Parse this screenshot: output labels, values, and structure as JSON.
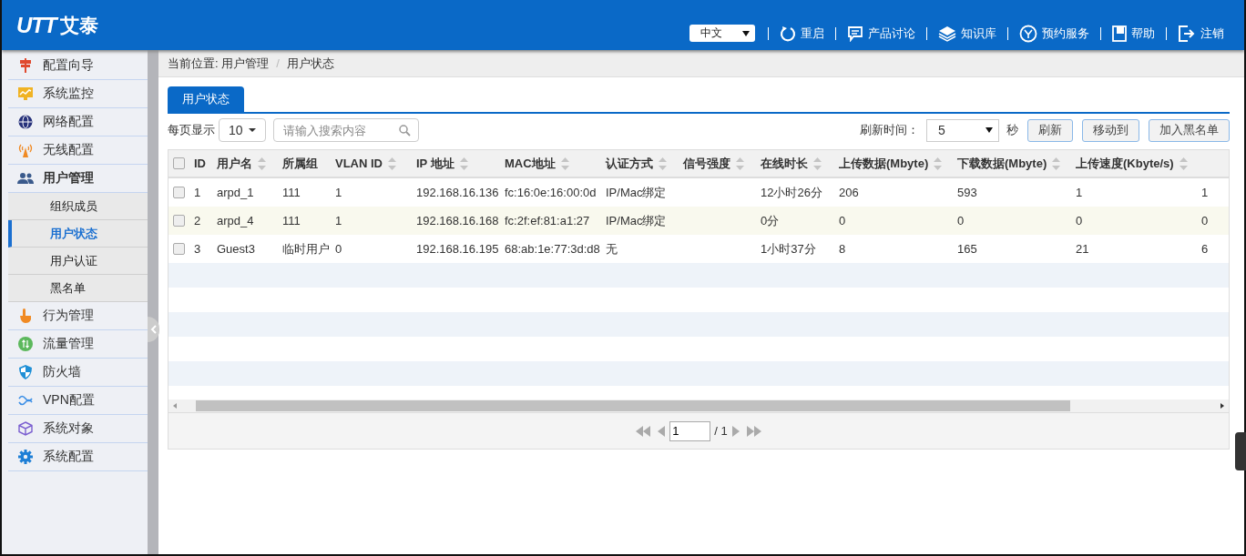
{
  "header": {
    "logo": {
      "mark": "UTT",
      "name": "艾泰"
    },
    "language": "中文",
    "links": [
      {
        "label": "重启"
      },
      {
        "label": "产品讨论"
      },
      {
        "label": "知识库"
      },
      {
        "label": "预约服务"
      },
      {
        "label": "帮助"
      },
      {
        "label": "注销"
      }
    ]
  },
  "sidebar": {
    "items": [
      {
        "label": "配置向导",
        "expanded": false
      },
      {
        "label": "系统监控",
        "expanded": false
      },
      {
        "label": "网络配置",
        "expanded": false
      },
      {
        "label": "无线配置",
        "expanded": false
      },
      {
        "label": "用户管理",
        "expanded": true,
        "children": [
          {
            "label": "组织成员",
            "selected": false
          },
          {
            "label": "用户状态",
            "selected": true
          },
          {
            "label": "用户认证",
            "selected": false
          },
          {
            "label": "黑名单",
            "selected": false
          }
        ]
      },
      {
        "label": "行为管理",
        "expanded": false
      },
      {
        "label": "流量管理",
        "expanded": false
      },
      {
        "label": "防火墙",
        "expanded": false
      },
      {
        "label": "VPN配置",
        "expanded": false
      },
      {
        "label": "系统对象",
        "expanded": false
      },
      {
        "label": "系统配置",
        "expanded": false
      }
    ]
  },
  "breadcrumb": {
    "prefix": "当前位置:",
    "items": [
      "用户管理",
      "用户状态"
    ],
    "separator": "/"
  },
  "tabs": [
    {
      "label": "用户状态",
      "selected": true
    }
  ],
  "toolbar": {
    "page_size_label": "每页显示",
    "page_size": "10",
    "search": {
      "placeholder": "请输入搜索内容"
    },
    "refresh_label": "刷新时间：",
    "refresh_interval": "5",
    "refresh_unit": "秒",
    "buttons": [
      "刷新",
      "移动到",
      "加入黑名单"
    ]
  },
  "table": {
    "select_all_checked": false,
    "columns": [
      {
        "label": "ID",
        "sortable": false
      },
      {
        "label": "用户名",
        "sortable": true
      },
      {
        "label": "所属组",
        "sortable": false
      },
      {
        "label": "VLAN ID",
        "sortable": true
      },
      {
        "label": "IP 地址",
        "sortable": true
      },
      {
        "label": "MAC地址",
        "sortable": true
      },
      {
        "label": "认证方式",
        "sortable": true
      },
      {
        "label": "信号强度",
        "sortable": true
      },
      {
        "label": "在线时长",
        "sortable": true
      },
      {
        "label": "上传数据(Mbyte)",
        "sortable": true
      },
      {
        "label": "下载数据(Mbyte)",
        "sortable": true
      },
      {
        "label": "上传速度(Kbyte/s)",
        "sortable": true
      }
    ],
    "rows": [
      {
        "checked": false,
        "highlighted": false,
        "cells": [
          "1",
          "arpd_1",
          "111",
          "1",
          "192.168.16.136",
          "fc:16:0e:16:00:0d",
          "IP/Mac绑定",
          "",
          "12小时26分",
          "206",
          "593",
          "1",
          "1"
        ]
      },
      {
        "checked": false,
        "highlighted": true,
        "cells": [
          "2",
          "arpd_4",
          "111",
          "1",
          "192.168.16.168",
          "fc:2f:ef:81:a1:27",
          "IP/Mac绑定",
          "",
          "0分",
          "0",
          "0",
          "0",
          "0"
        ]
      },
      {
        "checked": false,
        "highlighted": false,
        "cells": [
          "3",
          "Guest3",
          "临时用户",
          "0",
          "192.168.16.195",
          "68:ab:1e:77:3d:d8",
          "无",
          "",
          "1小时37分",
          "8",
          "165",
          "21",
          "6"
        ]
      }
    ]
  },
  "pager": {
    "page": "1",
    "total": "/ 1"
  }
}
